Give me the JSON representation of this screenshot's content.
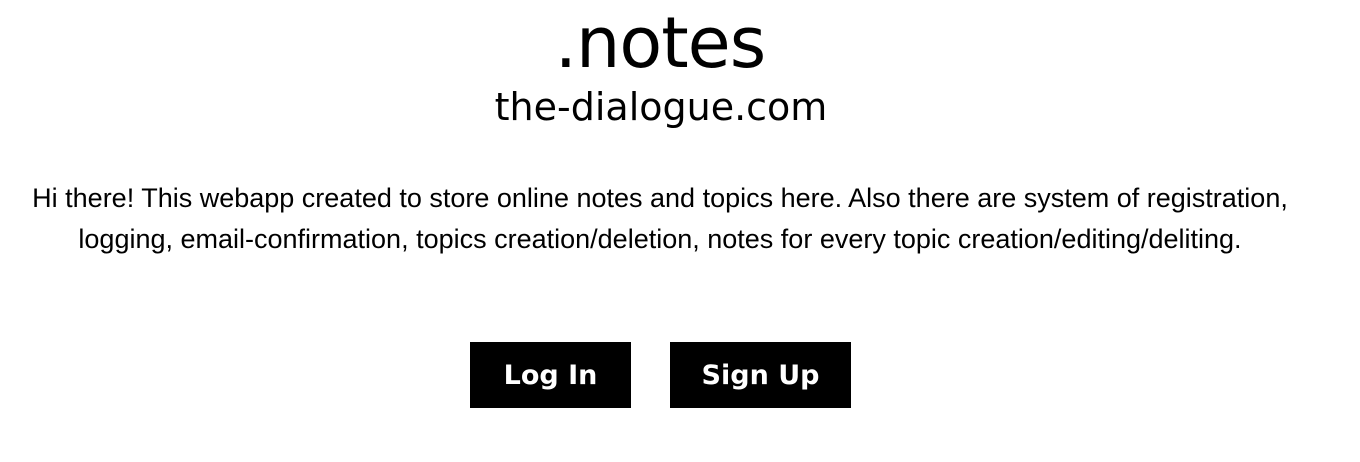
{
  "header": {
    "brand": ".notes",
    "domain": "the-dialogue.com"
  },
  "intro": {
    "text": "Hi there! This webapp created to store online notes and topics here. Also there are system of registration, logging, email-confirmation, topics creation/deletion, notes for every topic creation/editing/deliting."
  },
  "actions": {
    "login_label": "Log In",
    "signup_label": "Sign Up"
  },
  "colors": {
    "background": "#ffffff",
    "text": "#000000",
    "button_bg": "#000000",
    "button_text": "#ffffff"
  }
}
